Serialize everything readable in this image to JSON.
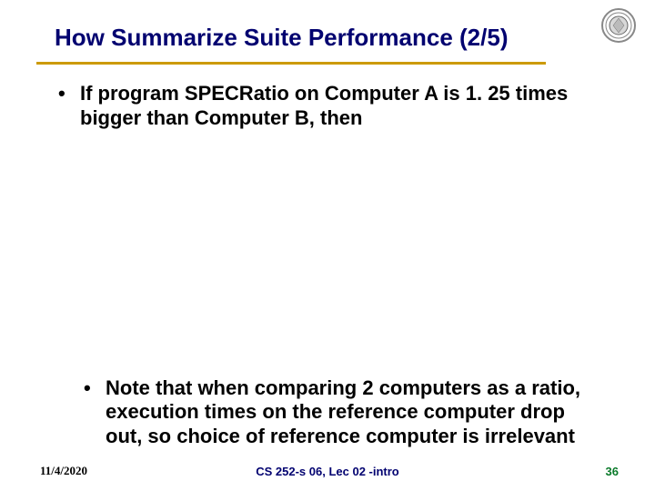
{
  "title": "How Summarize Suite Performance (2/5)",
  "bullets": {
    "b1": "If program SPECRatio on Computer A is 1. 25 times bigger than Computer B, then",
    "b2": "Note that when comparing 2 computers as a ratio, execution times on the reference computer drop out, so choice of reference computer is irrelevant"
  },
  "footer": {
    "date": "11/4/2020",
    "center": "CS 252-s 06, Lec 02 -intro",
    "page": "36"
  }
}
